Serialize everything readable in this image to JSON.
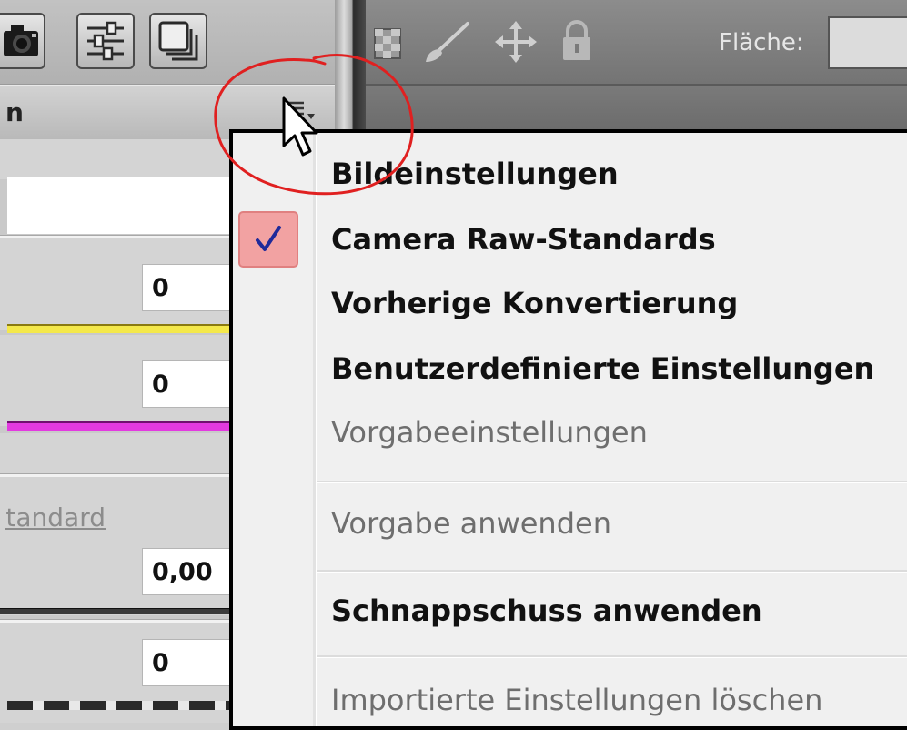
{
  "left_panel": {
    "title": "n",
    "toolbar_icons": [
      "camera-icon",
      "sliders-icon",
      "layers-icon"
    ],
    "fields": [
      {
        "value": "0",
        "track_color": "#f4e84a"
      },
      {
        "value": "0",
        "track_color": "#e33ae0"
      },
      {
        "value": "0,00"
      },
      {
        "value": "0"
      }
    ],
    "link_text": "Standard"
  },
  "right_toolbar": {
    "icons": [
      "checker-icon",
      "brush-icon",
      "move-icon",
      "lock-icon"
    ],
    "flaeche_label": "Fläche:"
  },
  "menu": {
    "items": [
      {
        "label": "Bildeinstellungen",
        "style": "bold",
        "checked": false
      },
      {
        "label": "Camera Raw-Standards",
        "style": "bold",
        "checked": true
      },
      {
        "label": "Vorherige Konvertierung",
        "style": "bold",
        "checked": false
      },
      {
        "label": "Benutzerdefinierte Einstellungen",
        "style": "bold",
        "checked": false
      },
      {
        "label": "Vorgabeeinstellungen",
        "style": "disabled",
        "checked": false
      },
      {
        "label": "Vorgabe anwenden",
        "style": "disabled",
        "checked": false
      },
      {
        "label": "Schnappschuss anwenden",
        "style": "bold",
        "checked": false
      },
      {
        "label": "Importierte Einstellungen löschen",
        "style": "disabled",
        "checked": false
      }
    ]
  },
  "colors": {
    "check_highlight": "#f2a2a2",
    "checkmark": "#1f2a9a",
    "annotation": "#e02020"
  }
}
